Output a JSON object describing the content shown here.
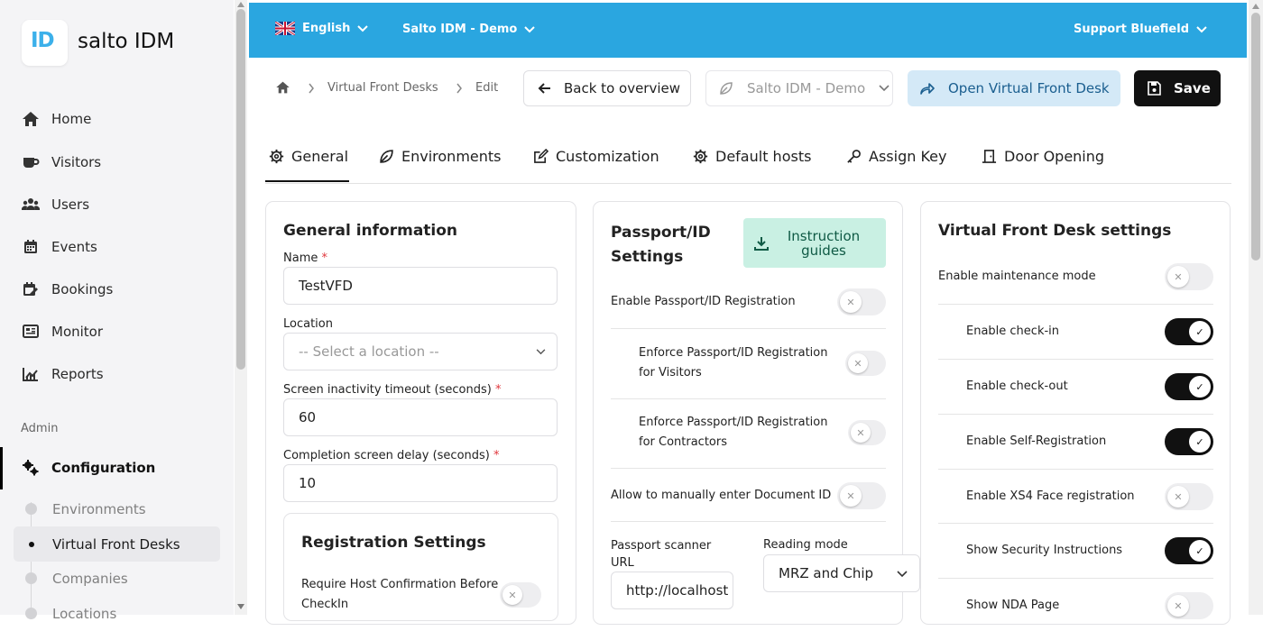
{
  "app": {
    "logo_mark": "ID",
    "name": "salto IDM"
  },
  "sidebar": {
    "nav": [
      {
        "label": "Home",
        "icon": "home-icon"
      },
      {
        "label": "Visitors",
        "icon": "coffee-icon"
      },
      {
        "label": "Users",
        "icon": "users-icon"
      },
      {
        "label": "Events",
        "icon": "calendar-icon"
      },
      {
        "label": "Bookings",
        "icon": "calendar-edit-icon"
      },
      {
        "label": "Monitor",
        "icon": "monitor-icon"
      },
      {
        "label": "Reports",
        "icon": "chart-icon"
      }
    ],
    "section_label": "Admin",
    "config_label": "Configuration",
    "sub_items": [
      {
        "label": "Environments",
        "active": false
      },
      {
        "label": "Virtual Front Desks",
        "active": true
      },
      {
        "label": "Companies",
        "active": false
      },
      {
        "label": "Locations",
        "active": false
      }
    ]
  },
  "topbar": {
    "language": "English",
    "environment": "Salto IDM - Demo",
    "user": "Support Bluefield",
    "accent_color": "#2aa6e0"
  },
  "breadcrumb": {
    "items": [
      "Virtual Front Desks",
      "Edit"
    ]
  },
  "actions": {
    "back_label": "Back to overview",
    "env_select": "Salto IDM - Demo",
    "open_label": "Open Virtual Front Desk",
    "save_label": "Save"
  },
  "tabs": [
    {
      "label": "General",
      "icon": "gear-icon"
    },
    {
      "label": "Environments",
      "icon": "leaf-icon"
    },
    {
      "label": "Customization",
      "icon": "edit-icon"
    },
    {
      "label": "Default hosts",
      "icon": "gear-icon"
    },
    {
      "label": "Assign Key",
      "icon": "key-icon"
    },
    {
      "label": "Door Opening",
      "icon": "door-icon"
    }
  ],
  "general": {
    "title": "General information",
    "name_label": "Name",
    "name_value": "TestVFD",
    "location_label": "Location",
    "location_placeholder": "-- Select a location --",
    "timeout_label": "Screen inactivity timeout (seconds)",
    "timeout_value": "60",
    "delay_label": "Completion screen delay (seconds)",
    "delay_value": "10",
    "required_mark": "*",
    "registration": {
      "title": "Registration Settings",
      "require_host_label": "Require Host Confirmation Before CheckIn"
    }
  },
  "passport": {
    "title": "Passport/ID Settings",
    "guides_label": "Instruction guides",
    "rows": [
      {
        "label": "Enable Passport/ID Registration",
        "on": false
      },
      {
        "label": "Enforce Passport/ID Registration for Visitors",
        "on": false
      },
      {
        "label": "Enforce Passport/ID Registration for Contractors",
        "on": false
      },
      {
        "label": "Allow to manually enter Document ID",
        "on": false
      }
    ],
    "scanner_label": "Passport scanner URL",
    "scanner_value": "http://localhost",
    "reading_label": "Reading mode",
    "reading_value": "MRZ and Chip"
  },
  "vfd": {
    "title": "Virtual Front Desk settings",
    "rows": [
      {
        "label": "Enable maintenance mode",
        "on": false
      },
      {
        "label": "Enable check-in",
        "on": true
      },
      {
        "label": "Enable check-out",
        "on": true
      },
      {
        "label": "Enable Self-Registration",
        "on": true
      },
      {
        "label": "Enable XS4 Face registration",
        "on": false
      },
      {
        "label": "Show Security Instructions",
        "on": true
      },
      {
        "label": "Show NDA Page",
        "on": false
      }
    ]
  }
}
